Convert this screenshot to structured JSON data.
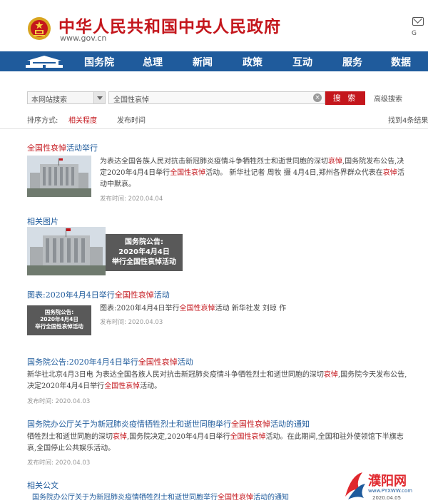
{
  "header": {
    "site_name": "中华人民共和国中央人民政府",
    "site_url": "www.gov.cn",
    "extra_label": "G"
  },
  "nav": {
    "items": [
      "国务院",
      "总理",
      "新闻",
      "政策",
      "互动",
      "服务",
      "数据"
    ]
  },
  "search": {
    "scope": "本网站搜索",
    "query": "全国性哀悼",
    "button_label": "搜 索",
    "advanced_label": "高级搜索"
  },
  "sort": {
    "label": "排序方式:",
    "options": [
      "相关程度",
      "发布时间"
    ],
    "active": "相关程度",
    "result_count": "找到4条结果"
  },
  "results": [
    {
      "title_prefix": "",
      "title_highlight": "全国性哀悼",
      "title_suffix": "活动举行",
      "snippet_parts": [
        "为表达全国各族人民对抗击新冠肺炎疫情斗争牺牲烈士和逝世同胞的深切",
        "哀悼",
        ",国务院发布公告,决定2020年4月4日举行",
        "全国性哀悼",
        "活动。 新华社记者 周牧 摄 4月4日,郑州各界群众代表在",
        "哀悼",
        "活动中默哀。"
      ],
      "meta": "发布时间: 2020.04.04"
    },
    {
      "title_prefix": "图表:2020年4月4日举行",
      "title_highlight": "全国性哀悼",
      "title_suffix": "活动",
      "snippet_parts": [
        "图表:2020年4月4日举行",
        "全国性哀悼",
        "活动 新华社发 刘琼 作"
      ],
      "meta": "发布时间: 2020.04.03"
    },
    {
      "title_prefix": "国务院公告:2020年4月4日举行",
      "title_highlight": "全国性哀悼",
      "title_suffix": "活动",
      "snippet_parts": [
        "新华社北京4月3日电 为表达全国各族人民对抗击新冠肺炎疫情斗争牺牲烈士和逝世同胞的深切",
        "哀悼",
        ",国务院今天发布公告,决定2020年4月4日举行",
        "全国性哀悼",
        "活动。"
      ],
      "meta": "发布时间: 2020.04.03"
    },
    {
      "title_prefix": "国务院办公厅关于为新冠肺炎疫情牺牲烈士和逝世同胞举行",
      "title_highlight": "全国性哀悼",
      "title_suffix": "活动的通知",
      "snippet_parts": [
        "牺牲烈士和逝世同胞的深切",
        "哀悼",
        ",国务院决定,2020年4月4日举行",
        "全国性哀悼",
        "活动。在此期间,全国和驻外使领馆下半旗志哀,全国停止公共娱乐活动。"
      ],
      "meta": "发布时间: 2020.04.03"
    }
  ],
  "related_images": {
    "label": "相关图片",
    "card_lines": [
      "国务院公告:",
      "2020年4月4日",
      "举行全国性哀悼活动"
    ]
  },
  "related_docs": {
    "label": "相关公文",
    "title_prefix": "国务院办公厅关于为新冠肺炎疫情牺牲烈士和逝世同胞举行",
    "title_highlight": "全国性哀悼",
    "title_suffix": "活动的通知"
  },
  "watermark": {
    "name": "濮阳网",
    "url": "www.PYXWW.com",
    "date": "2020.04.05"
  },
  "colors": {
    "brand_red": "#c4161c",
    "nav_blue": "#1f5b9c",
    "link_blue": "#1f5b9c"
  }
}
